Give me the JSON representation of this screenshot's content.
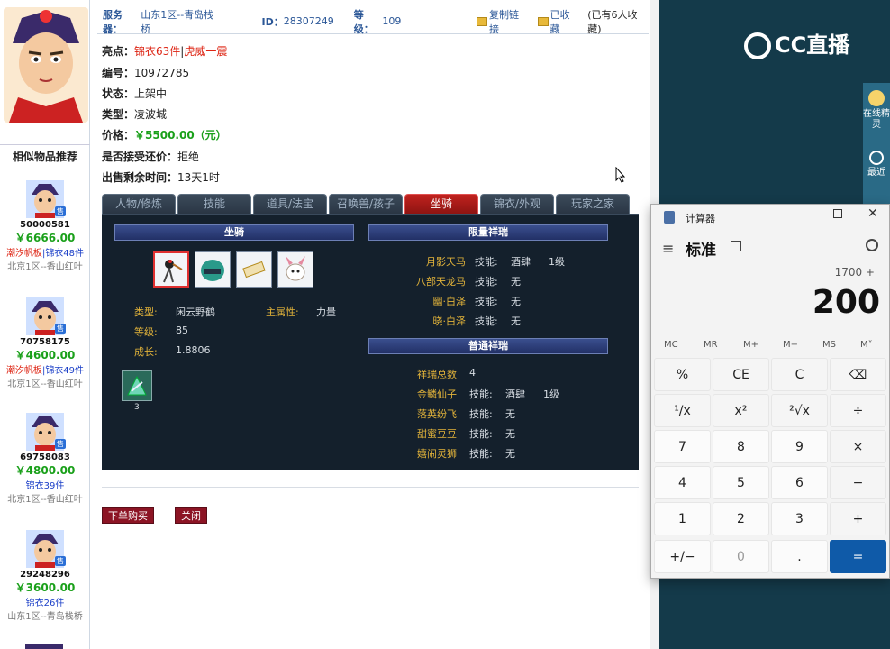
{
  "header": {
    "server_label": "服务器：",
    "server_value": "山东1区--青岛栈桥",
    "id_label": "ID：",
    "id_value": "28307249",
    "level_label": "等级：",
    "level_value": "109",
    "copy_link": "复制链接",
    "favorited": "已收藏",
    "fav_count_text": "(已有6人收藏)"
  },
  "info": {
    "highlight_label": "亮点：",
    "highlight_a": "锦衣63件",
    "highlight_sep": "|",
    "highlight_b": "虎威一震",
    "number_label": "编号：",
    "number_value": "10972785",
    "status_label": "状态：",
    "status_value": "上架中",
    "type_label": "类型：",
    "type_value": "凌波城",
    "price_label": "价格：",
    "price_value": "￥5500.00（元）",
    "counter_label": "是否接受还价：",
    "counter_value": "拒绝",
    "remain_label": "出售剩余时间：",
    "remain_value": "13天1时"
  },
  "tabs": [
    "人物/修炼",
    "技能",
    "道具/法宝",
    "召唤兽/孩子",
    "坐骑",
    "锦衣/外观",
    "玩家之家"
  ],
  "active_tab": "坐骑",
  "panel": {
    "mount_header": "坐骑",
    "limited_header": "限量祥瑞",
    "normal_header": "普通祥瑞",
    "mount_type_label": "类型:",
    "mount_type_value": "闲云野鹤",
    "main_attr_label": "主属性:",
    "main_attr_value": "力量",
    "level_label": "等级:",
    "level_value": "85",
    "growth_label": "成长:",
    "growth_value": "1.8806",
    "item_count": "3",
    "limited": [
      {
        "name": "月影天马",
        "skill_label": "技能:",
        "skill": "酒肆",
        "lv": "1级"
      },
      {
        "name": "八部天龙马",
        "skill_label": "技能:",
        "skill": "无",
        "lv": ""
      },
      {
        "name": "幽·白泽",
        "skill_label": "技能:",
        "skill": "无",
        "lv": ""
      },
      {
        "name": "晓·白泽",
        "skill_label": "技能:",
        "skill": "无",
        "lv": ""
      }
    ],
    "normal_total_label": "祥瑞总数",
    "normal_total": "4",
    "normal": [
      {
        "name": "金鳞仙子",
        "skill_label": "技能:",
        "skill": "酒肆",
        "lv": "1级"
      },
      {
        "name": "落英纷飞",
        "skill_label": "技能:",
        "skill": "无",
        "lv": ""
      },
      {
        "name": "甜蜜豆豆",
        "skill_label": "技能:",
        "skill": "无",
        "lv": ""
      },
      {
        "name": "嬉闹灵狮",
        "skill_label": "技能:",
        "skill": "无",
        "lv": ""
      }
    ]
  },
  "actions": {
    "buy": "下单购买",
    "close": "关闭"
  },
  "sidebar": {
    "title": "相似物品推荐",
    "badge": "售",
    "items": [
      {
        "id": "50000581",
        "price": "￥6666.00",
        "tag_red": "潮汐帆板",
        "tag_sep": "|",
        "tag_blue": "锦衣48件",
        "server": "北京1区--香山红叶"
      },
      {
        "id": "70758175",
        "price": "￥4600.00",
        "tag_red": "潮汐帆板",
        "tag_sep": "|",
        "tag_blue": "锦衣49件",
        "server": "北京1区--香山红叶"
      },
      {
        "id": "69758083",
        "price": "￥4800.00",
        "tag_red": "",
        "tag_sep": "",
        "tag_blue": "锦衣39件",
        "server": "北京1区--香山红叶"
      },
      {
        "id": "29248296",
        "price": "￥3600.00",
        "tag_red": "",
        "tag_sep": "",
        "tag_blue": "锦衣26件",
        "server": "山东1区--青岛栈桥"
      }
    ]
  },
  "right": {
    "logo": "CC直播",
    "online_sprite": "在线精灵",
    "recent": "最近"
  },
  "calculator": {
    "title": "计算器",
    "mode": "标准",
    "expression": "1700 +",
    "display": "200",
    "memory": [
      "MC",
      "MR",
      "M+",
      "M−",
      "MS",
      "M˅"
    ],
    "keys": [
      [
        "%",
        "CE",
        "C",
        "⌫"
      ],
      [
        "¹/x",
        "x²",
        "²√x",
        "÷"
      ],
      [
        "7",
        "8",
        "9",
        "×"
      ],
      [
        "4",
        "5",
        "6",
        "−"
      ],
      [
        "1",
        "2",
        "3",
        "+"
      ],
      [
        "+/−",
        "0",
        ".",
        "="
      ]
    ]
  }
}
